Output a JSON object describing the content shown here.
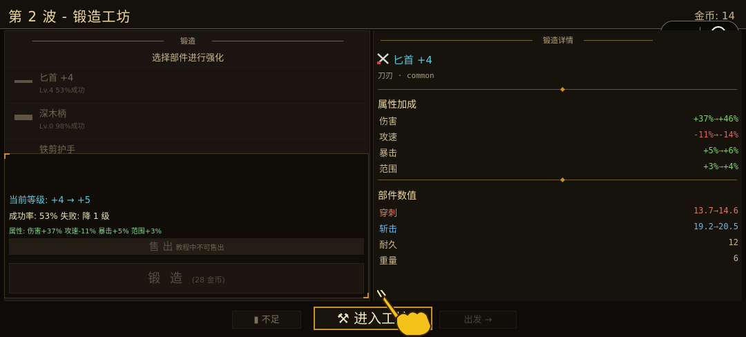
{
  "header": {
    "title": "第 2 波 - 锻造工坊",
    "coins": "金币: 14"
  },
  "left": {
    "section_title": "锻造",
    "subtitle": "选择部件进行强化",
    "parts": [
      {
        "name": "匕首 +4",
        "meta": "Lv.4  53%成功"
      },
      {
        "name": "深木柄",
        "meta": "Lv.0  98%成功"
      },
      {
        "name": "铁剪护手",
        "meta": ""
      }
    ],
    "popup": {
      "level": "当前等级: +4  →  +5",
      "rate": "成功率: 53%  失败: 降 1 级",
      "attrs": "属性: 伤害+37% 攻速-11% 暴击+5% 范围+3%",
      "sell_label": "售 出",
      "sell_note": "教程中不可售出",
      "forge_label": "锻 造",
      "forge_cost": "(28 金币)"
    }
  },
  "right": {
    "section_title": "锻造详情",
    "item_name": "匕首  +4",
    "item_sub": "刀刃 · common",
    "bonus_title": "属性加成",
    "bonuses": [
      {
        "k": "伤害",
        "from": "+37%",
        "to": "+46%",
        "color": "#7fd36a"
      },
      {
        "k": "攻速",
        "from": "-11%",
        "to": "-14%",
        "color": "#e0645a"
      },
      {
        "k": "暴击",
        "from": "+5%",
        "to": "+6%",
        "color": "#7fd36a"
      },
      {
        "k": "范围",
        "from": "+3%",
        "to": "+4%",
        "color": "#7fd36a"
      }
    ],
    "values_title": "部件数值",
    "values": [
      {
        "k": "穿刺",
        "from": "13.7",
        "to": "14.6",
        "kcolor": "red",
        "color": "#e07a5f"
      },
      {
        "k": "斩击",
        "from": "19.2",
        "to": "20.5",
        "kcolor": "blue",
        "color": "#6fb4e8"
      },
      {
        "k": "耐久",
        "from": "",
        "to": "12",
        "kcolor": "",
        "color": "#c9b88e"
      },
      {
        "k": "重量",
        "from": "",
        "to": "6",
        "kcolor": "",
        "color": "#c9b88e"
      }
    ]
  },
  "bottom": {
    "insufficient": "不足",
    "enter": "进入工坊",
    "depart": "出发 →"
  },
  "colors": {
    "gold": "#c8912e",
    "cyan": "#5ec9e0",
    "green": "#7fd36a",
    "red": "#e0645a"
  }
}
